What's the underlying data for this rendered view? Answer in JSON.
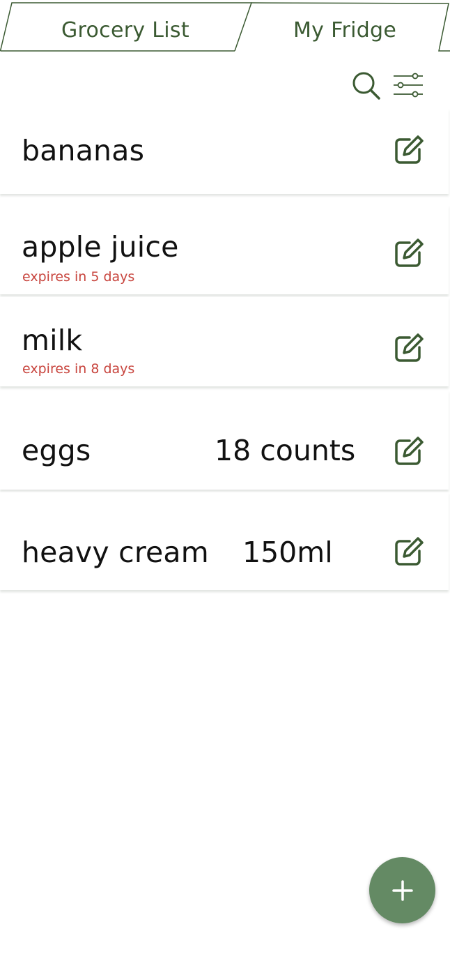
{
  "tabs": [
    {
      "label": "Grocery List",
      "active": false
    },
    {
      "label": "My Fridge",
      "active": true
    }
  ],
  "toolbar": {
    "search_icon": "search-icon",
    "filter_icon": "sliders-icon"
  },
  "items": [
    {
      "name": "bananas",
      "note": "",
      "quantity": ""
    },
    {
      "name": "apple juice",
      "note": "expires in 5 days",
      "quantity": ""
    },
    {
      "name": "milk",
      "note": "expires in 8 days",
      "quantity": ""
    },
    {
      "name": "eggs",
      "note": "",
      "quantity": "18 counts"
    },
    {
      "name": "heavy cream",
      "note": "",
      "quantity": "150ml"
    }
  ],
  "fab": {
    "icon": "plus-icon"
  },
  "colors": {
    "accent": "#3b5a32",
    "fab": "#648a64",
    "warning": "#c8453e"
  }
}
